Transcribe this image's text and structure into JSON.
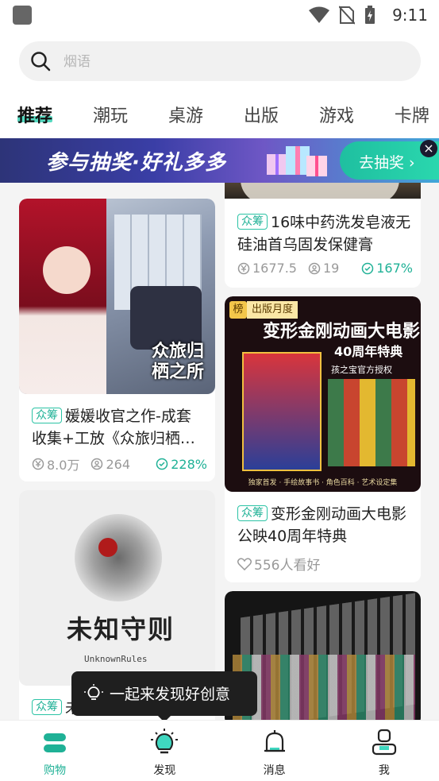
{
  "status_bar": {
    "time": "9:11"
  },
  "search": {
    "placeholder": "烟语"
  },
  "tabs": [
    {
      "label": "推荐",
      "active": true
    },
    {
      "label": "潮玩"
    },
    {
      "label": "桌游"
    },
    {
      "label": "出版"
    },
    {
      "label": "游戏"
    },
    {
      "label": "卡牌"
    }
  ],
  "banner": {
    "text": "参与抽奖·好礼多多",
    "cta": "去抽奖 ›"
  },
  "cards": [
    {
      "tag": "众筹",
      "title": "16味中药洗发皂液无硅油首乌固发保健膏",
      "stats": {
        "amount": "1677.5",
        "backers": "19",
        "percent": "167%"
      }
    },
    {
      "tag": "众筹",
      "title": "媛媛收官之作-成套收集+工放《众旅归栖…",
      "image_text": "众旅归栖之所",
      "stats": {
        "amount": "8.0万",
        "backers": "264",
        "percent": "228%"
      }
    },
    {
      "tag": "众筹",
      "title": "变形金刚动画大电影公映40周年特典",
      "image_badges": {
        "rank": "榜",
        "category": "出版月度"
      },
      "image_title": "变形金刚动画大电影",
      "image_subtitle": "40周年特典",
      "image_license": "孩之宝官方授权",
      "image_footer": "独家首发 · 手绘故事书 · 角色百科 · 艺术设定集",
      "stats": {
        "likes": "556人看好"
      }
    },
    {
      "tag": "众筹",
      "title": "未",
      "image_title": "未知守则",
      "image_subtitle": "UnknownRules"
    }
  ],
  "toast": {
    "text": "一起来发现好创意"
  },
  "bottom_nav": [
    {
      "label": "购物",
      "active": true
    },
    {
      "label": "发现"
    },
    {
      "label": "消息"
    },
    {
      "label": "我"
    }
  ],
  "colors": {
    "accent": "#1fb196",
    "tag_border": "#2bc3a5"
  }
}
